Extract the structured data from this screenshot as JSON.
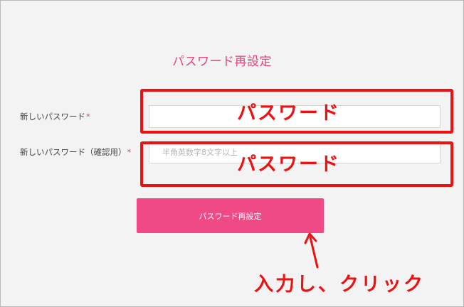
{
  "page": {
    "title": "パスワード再設定"
  },
  "form": {
    "new_password": {
      "label": "新しいパスワード",
      "required_mark": "*",
      "value": "",
      "placeholder": ""
    },
    "confirm_password": {
      "label": "新しいパスワード（確認用）",
      "required_mark": "*",
      "value": "",
      "placeholder": "半角英数字8文字以上"
    },
    "submit_label": "パスワード再設定"
  },
  "annotations": {
    "field_1_text": "パスワード",
    "field_2_text": "パスワード",
    "instruction": "入力し、クリック",
    "color": "#ee1111"
  },
  "colors": {
    "accent": "#e4457e",
    "button": "#ef4a86",
    "background": "#f3f3f3"
  }
}
